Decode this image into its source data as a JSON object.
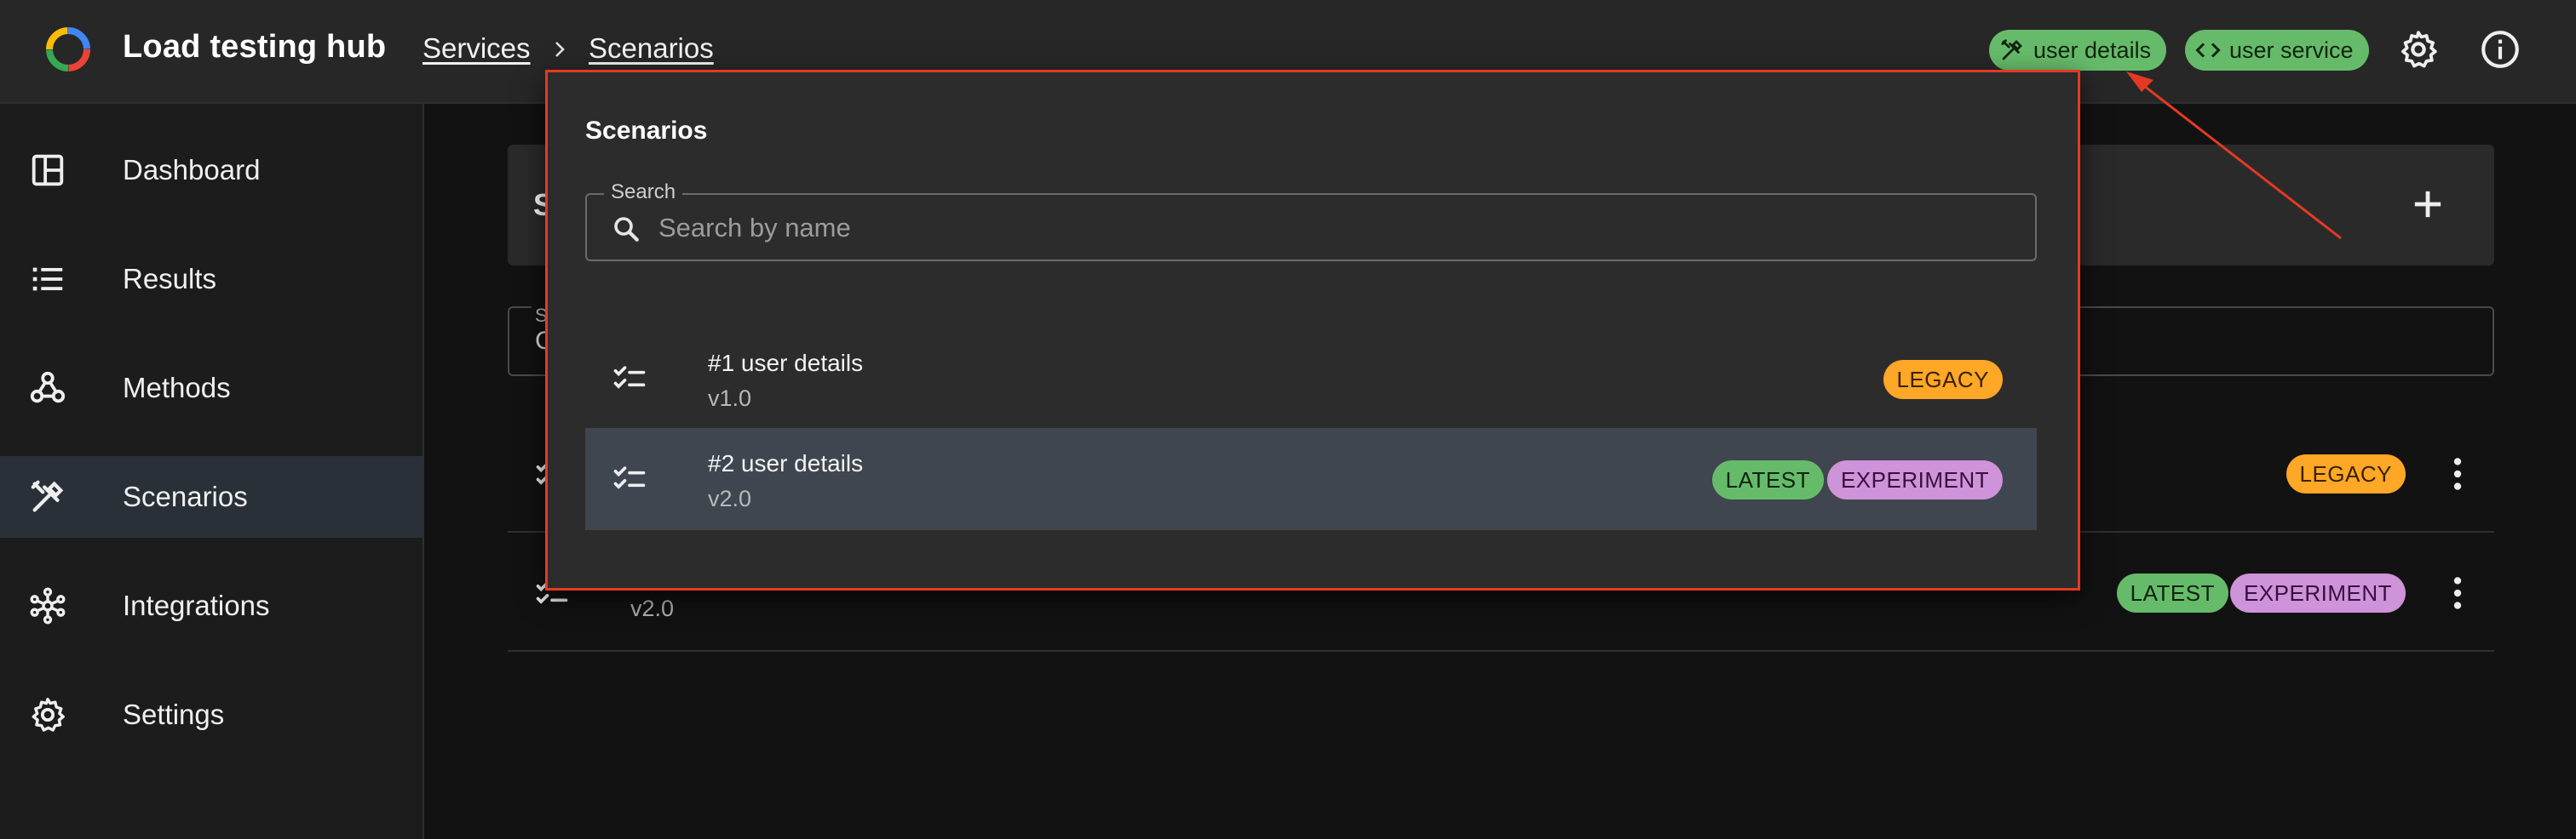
{
  "appbar": {
    "title": "Load testing hub",
    "breadcrumbs": [
      "Services",
      "Scenarios"
    ],
    "chips": [
      {
        "label": "user details",
        "icon": "tools-icon"
      },
      {
        "label": "user service",
        "icon": "code-icon"
      }
    ],
    "icons": [
      "gear-icon",
      "info-icon"
    ]
  },
  "sidebar": {
    "items": [
      {
        "label": "Dashboard",
        "icon": "dashboard-icon"
      },
      {
        "label": "Results",
        "icon": "list-icon"
      },
      {
        "label": "Methods",
        "icon": "webhook-icon"
      },
      {
        "label": "Scenarios",
        "icon": "tools-icon",
        "active": true
      },
      {
        "label": "Integrations",
        "icon": "hub-icon"
      },
      {
        "label": "Settings",
        "icon": "gear-icon"
      }
    ]
  },
  "main": {
    "header_letter": "S",
    "search_label": "S",
    "search_value_letter": "C",
    "rows": [
      {
        "version": "",
        "badges": [
          "LEGACY"
        ]
      },
      {
        "version": "v2.0",
        "badges": [
          "LATEST",
          "EXPERIMENT"
        ]
      }
    ]
  },
  "popover": {
    "title": "Scenarios",
    "search": {
      "label": "Search",
      "placeholder": "Search by name",
      "value": ""
    },
    "items": [
      {
        "name": "#1 user details",
        "version": "v1.0",
        "badges": [
          "LEGACY"
        ]
      },
      {
        "name": "#2 user details",
        "version": "v2.0",
        "badges": [
          "LATEST",
          "EXPERIMENT"
        ],
        "selected": true
      }
    ]
  },
  "colors": {
    "accent_green": "#66bb6a",
    "legacy_orange": "#ffa726",
    "experiment_purple": "#ce93d8",
    "highlight_red": "#e53923"
  }
}
